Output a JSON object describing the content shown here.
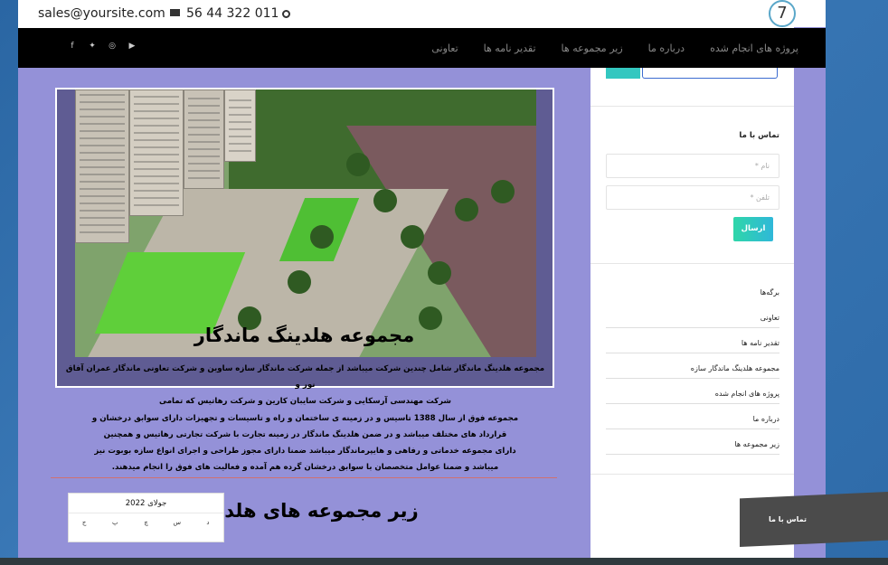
{
  "topbar": {
    "email": "sales@yoursite.com",
    "phone": "56 44 322 011",
    "badge": "7"
  },
  "nav": {
    "items": [
      "پروژه های انجام شده",
      "درباره ما",
      "زیر مجموعه ها",
      "تقدیر نامه ها",
      "تعاونی"
    ],
    "social_icons": [
      "youtube-icon",
      "instagram-icon",
      "twitter-icon",
      "facebook-icon"
    ]
  },
  "main": {
    "title": "مجموعه هلدینگ ماندگار",
    "body_lines": [
      "مجموعه هلدینگ ماندگار شامل چندین شرکت میباشد از جمله شرکت  ماندگار سازه ساوین و شرکت تعاونی ماندگار عمران آفاق نور و",
      "شرکت مهندسی آرسکایی و شرکت سایبان کارین و شرکت رهاتیس که تمامی",
      "مجموعه فوق از سال 1388 تاسیس و در زمینه ی ساختمان و راه و تاسیسات و تجهیزات دارای سوابق درخشان و",
      "قرارداد های مختلف میباشد و در ضمن هلدینگ ماندگار در زمینه تجارت با شرکت تجارتی رهاتیس و همچنین",
      "دارای مجموعه خدماتی و رفاهی و هایپرماندگار میباشد ضمنا دارای مجوز طراحی و اجرای انواع سازه بوبوت نیز",
      "میباشد و ضمنا عوامل متخصصان با سوابق درخشان گرده هم آمده و فعالیت های فوق را انجام میدهند."
    ],
    "subtitle": "زیر مجموعه های هلدینگ"
  },
  "sidebar": {
    "contact_title": "تماس با ما",
    "name_placeholder": "نام *",
    "phone_placeholder": "تلفن *",
    "send_label": "ارسال",
    "pages_title": "برگه‌ها",
    "links": [
      "تعاونی",
      "تقدیر نامه ها",
      "مجموعه هلدینگ ماندگار سازه",
      "پروژه های انجام شده",
      "درباره ما",
      "زیر مجموعه ها"
    ],
    "calendar_title": "جولای 2022",
    "calendar_days": [
      "د",
      "س",
      "چ",
      "پ",
      "ج"
    ]
  },
  "floating": {
    "label": "تماس با ما"
  },
  "colors": {
    "content_bg": "#9491d8",
    "nav_bg": "#000000",
    "accent": "#33c7c0"
  }
}
